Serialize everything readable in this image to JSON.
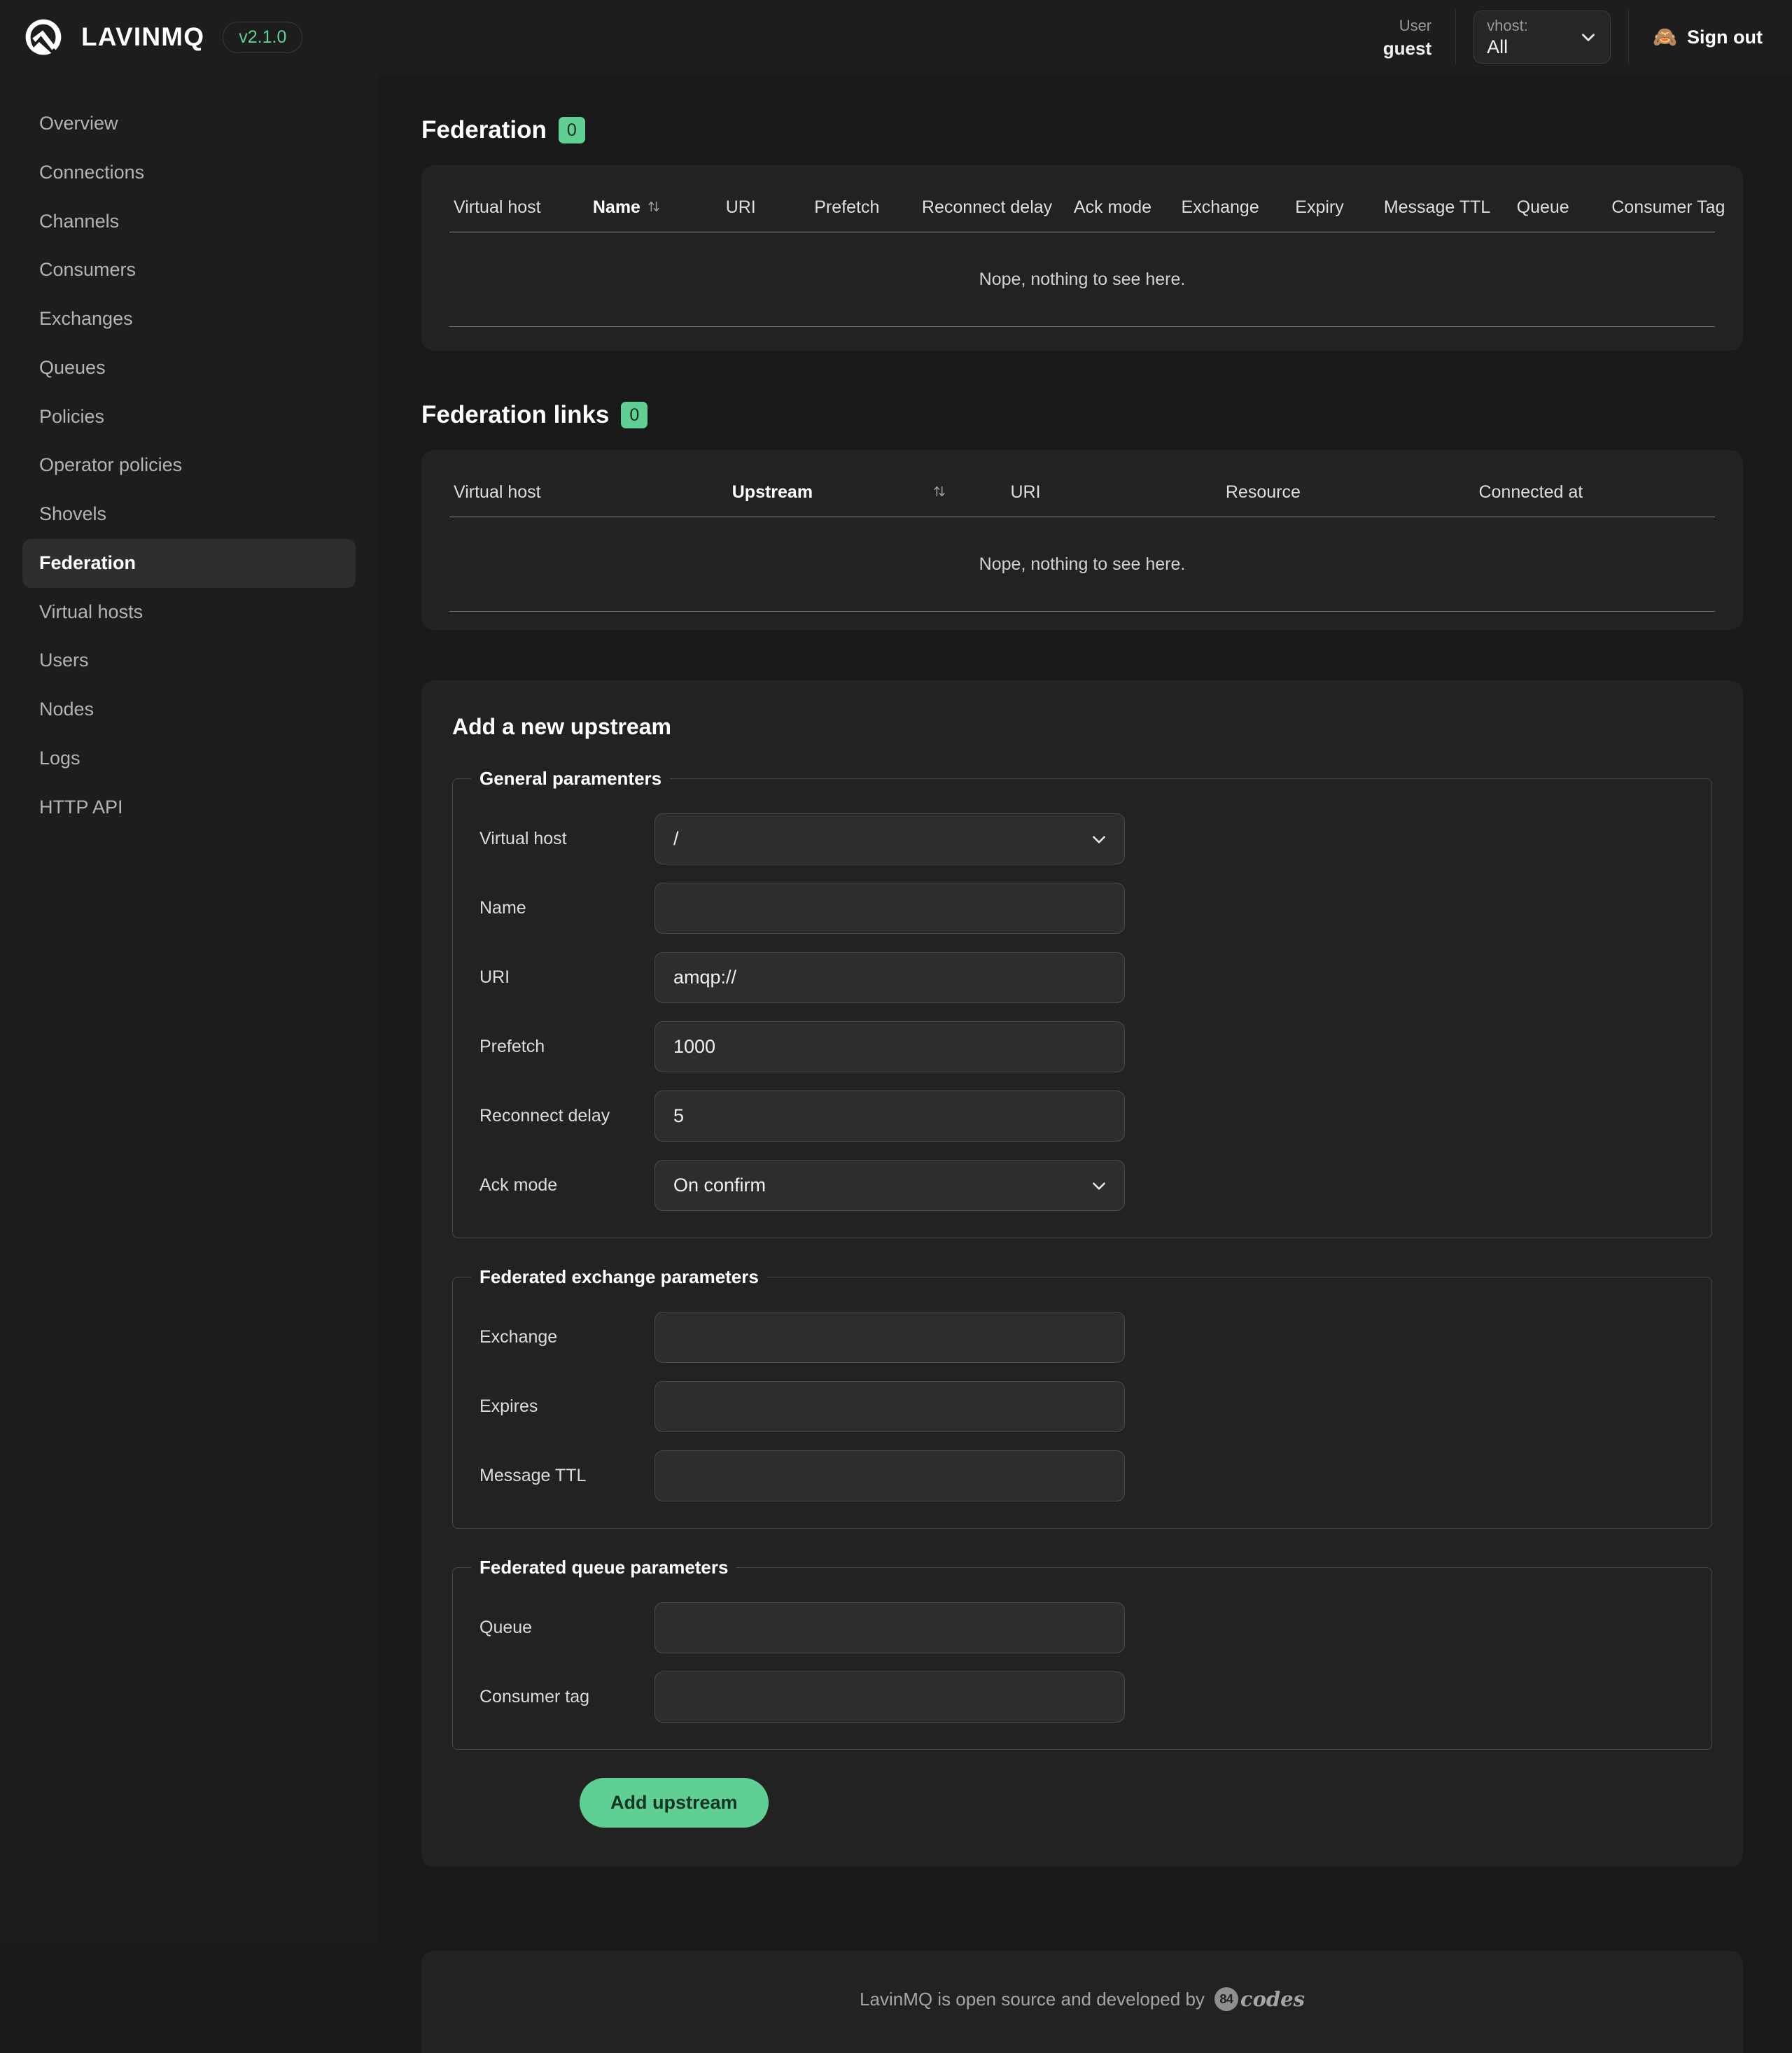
{
  "header": {
    "brand_name": "LAVINMQ",
    "version": "v2.1.0",
    "user_label": "User",
    "user_name": "guest",
    "vhost_label": "vhost:",
    "vhost_value": "All",
    "signout_label": "Sign out",
    "signout_icon": "see-no-evil-monkey"
  },
  "sidebar": {
    "items": [
      {
        "label": "Overview",
        "active": false
      },
      {
        "label": "Connections",
        "active": false
      },
      {
        "label": "Channels",
        "active": false
      },
      {
        "label": "Consumers",
        "active": false
      },
      {
        "label": "Exchanges",
        "active": false
      },
      {
        "label": "Queues",
        "active": false
      },
      {
        "label": "Policies",
        "active": false
      },
      {
        "label": "Operator policies",
        "active": false
      },
      {
        "label": "Shovels",
        "active": false
      },
      {
        "label": "Federation",
        "active": true
      },
      {
        "label": "Virtual hosts",
        "active": false
      },
      {
        "label": "Users",
        "active": false
      },
      {
        "label": "Nodes",
        "active": false
      },
      {
        "label": "Logs",
        "active": false
      },
      {
        "label": "HTTP API",
        "active": false
      }
    ]
  },
  "federation": {
    "title": "Federation",
    "count": "0",
    "columns": [
      "Virtual host",
      "Name",
      "URI",
      "Prefetch",
      "Reconnect delay",
      "Ack mode",
      "Exchange",
      "Expiry",
      "Message TTL",
      "Queue",
      "Consumer Tag"
    ],
    "sorted_column": "Name",
    "empty_message": "Nope, nothing to see here."
  },
  "federation_links": {
    "title": "Federation links",
    "count": "0",
    "columns": [
      "Virtual host",
      "Upstream",
      "URI",
      "Resource",
      "Connected at"
    ],
    "sorted_column": "Upstream",
    "empty_message": "Nope, nothing to see here."
  },
  "upstream_form": {
    "title": "Add a new upstream",
    "general": {
      "legend": "General paramenters",
      "virtual_host_label": "Virtual host",
      "virtual_host_value": "/",
      "name_label": "Name",
      "name_value": "",
      "uri_label": "URI",
      "uri_value": "amqp://",
      "prefetch_label": "Prefetch",
      "prefetch_value": "1000",
      "reconnect_delay_label": "Reconnect delay",
      "reconnect_delay_value": "5",
      "ack_mode_label": "Ack mode",
      "ack_mode_value": "On confirm"
    },
    "exchange": {
      "legend": "Federated exchange parameters",
      "exchange_label": "Exchange",
      "exchange_value": "",
      "expires_label": "Expires",
      "expires_value": "",
      "message_ttl_label": "Message TTL",
      "message_ttl_value": ""
    },
    "queue": {
      "legend": "Federated queue parameters",
      "queue_label": "Queue",
      "queue_value": "",
      "consumer_tag_label": "Consumer tag",
      "consumer_tag_value": ""
    },
    "submit_label": "Add upstream"
  },
  "footer": {
    "text": "LavinMQ is open source and developed by",
    "badge": "84",
    "brand": "codes"
  },
  "colors": {
    "accent": "#5fcf93",
    "page_bg": "#191919",
    "panel_bg": "#222222",
    "chrome_bg": "#1d1d1d",
    "input_bg": "#2d2d2d"
  }
}
